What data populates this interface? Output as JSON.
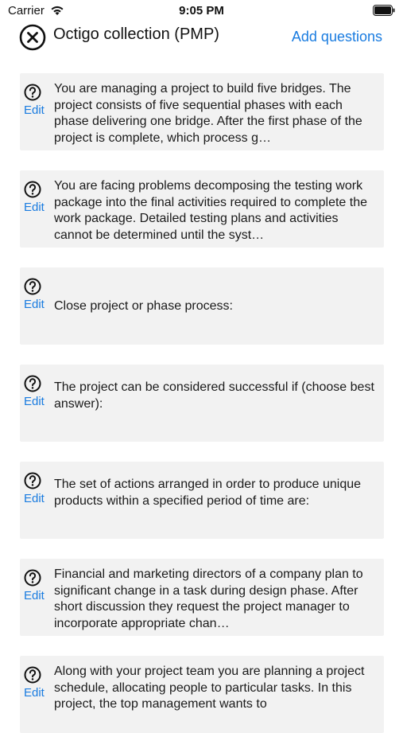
{
  "status": {
    "carrier": "Carrier",
    "time": "9:05 PM"
  },
  "nav": {
    "title": "Octigo collection (PMP)",
    "add_label": "Add questions"
  },
  "questions": [
    {
      "edit": "Edit",
      "text": "You are managing a project to build five bridges. The project consists of five sequential phases with each phase delivering one bridge.  After the first phase of the project is complete, which process g…"
    },
    {
      "edit": "Edit",
      "text": "You are facing problems decomposing the testing work package into the final activities required to complete the work package. Detailed testing plans and activities cannot be determined until the syst…"
    },
    {
      "edit": "Edit",
      "text": "Close project or phase process:"
    },
    {
      "edit": "Edit",
      "text": "The project can be considered successful if (choose best answer):"
    },
    {
      "edit": "Edit",
      "text": "The set of actions arranged in order to produce unique products within a specified period of time are:"
    },
    {
      "edit": "Edit",
      "text": "Financial and marketing directors of a company plan to significant change in a task during design phase. After short discussion they request the project manager to incorporate appropriate chan…"
    },
    {
      "edit": "Edit",
      "text": "Along with your project team you are planning a project schedule, allocating people to particular tasks. In this project, the top management wants to"
    }
  ]
}
